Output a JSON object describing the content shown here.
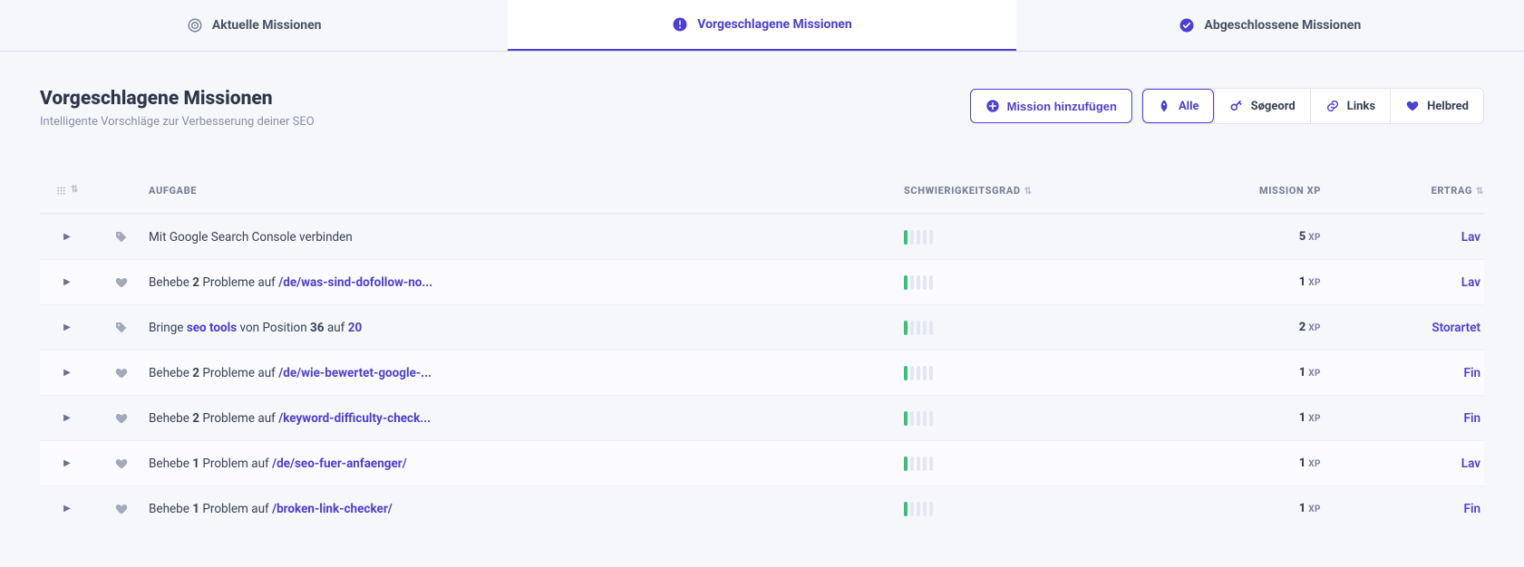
{
  "tabs": [
    {
      "label": "Aktuelle Missionen",
      "icon": "target",
      "active": false
    },
    {
      "label": "Vorgeschlagene Missionen",
      "icon": "exclaim",
      "active": true
    },
    {
      "label": "Abgeschlossene Missionen",
      "icon": "check",
      "active": false
    }
  ],
  "header": {
    "title": "Vorgeschlagene Missionen",
    "subtitle": "Intelligente Vorschläge zur Verbesserung deiner SEO",
    "add_button": "Mission hinzufügen",
    "filters": [
      {
        "label": "Alle",
        "icon": "rocket",
        "active": true
      },
      {
        "label": "Søgeord",
        "icon": "key",
        "active": false
      },
      {
        "label": "Links",
        "icon": "link",
        "active": false
      },
      {
        "label": "Helbred",
        "icon": "heart",
        "active": false
      }
    ]
  },
  "columns": {
    "aufgabe": "AUFGABE",
    "schwierigkeit": "SCHWIERIGKEITSGRAD",
    "xp": "MISSION XP",
    "ertrag": "ERTRAG"
  },
  "xp_unit": "XP",
  "rows": [
    {
      "icon": "tag",
      "task_parts": [
        [
          "plain",
          "Mit Google Search Console verbinden"
        ]
      ],
      "difficulty": 1,
      "xp": "5",
      "ertrag": "Lav"
    },
    {
      "icon": "heart",
      "task_parts": [
        [
          "plain",
          "Behebe "
        ],
        [
          "bold",
          "2"
        ],
        [
          "plain",
          " Probleme auf "
        ],
        [
          "link",
          "/de/was-sind-dofollow-no..."
        ]
      ],
      "difficulty": 1,
      "xp": "1",
      "ertrag": "Lav"
    },
    {
      "icon": "tag",
      "task_parts": [
        [
          "plain",
          "Bringe "
        ],
        [
          "link",
          "seo tools"
        ],
        [
          "plain",
          " von Position "
        ],
        [
          "bold",
          "36"
        ],
        [
          "plain",
          " auf "
        ],
        [
          "link",
          "20"
        ]
      ],
      "difficulty": 1,
      "xp": "2",
      "ertrag": "Storartet"
    },
    {
      "icon": "heart",
      "task_parts": [
        [
          "plain",
          "Behebe "
        ],
        [
          "bold",
          "2"
        ],
        [
          "plain",
          " Probleme auf "
        ],
        [
          "link",
          "/de/wie-bewertet-google-..."
        ]
      ],
      "difficulty": 1,
      "xp": "1",
      "ertrag": "Fin"
    },
    {
      "icon": "heart",
      "task_parts": [
        [
          "plain",
          "Behebe "
        ],
        [
          "bold",
          "2"
        ],
        [
          "plain",
          " Probleme auf "
        ],
        [
          "link",
          "/keyword-difficulty-check..."
        ]
      ],
      "difficulty": 1,
      "xp": "1",
      "ertrag": "Fin"
    },
    {
      "icon": "heart",
      "task_parts": [
        [
          "plain",
          "Behebe "
        ],
        [
          "bold",
          "1"
        ],
        [
          "plain",
          " Problem auf "
        ],
        [
          "link",
          "/de/seo-fuer-anfaenger/"
        ]
      ],
      "difficulty": 1,
      "xp": "1",
      "ertrag": "Lav"
    },
    {
      "icon": "heart",
      "task_parts": [
        [
          "plain",
          "Behebe "
        ],
        [
          "bold",
          "1"
        ],
        [
          "plain",
          " Problem auf "
        ],
        [
          "link",
          "/broken-link-checker/"
        ]
      ],
      "difficulty": 1,
      "xp": "1",
      "ertrag": "Fin"
    }
  ]
}
